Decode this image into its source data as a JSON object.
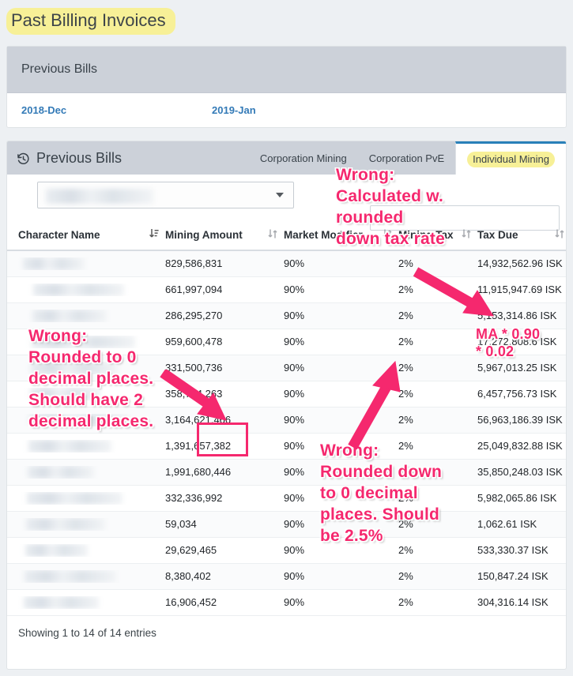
{
  "page": {
    "title": "Past Billing Invoices",
    "title_highlight_color": "#f7f097"
  },
  "previous_bills_panel": {
    "header": "Previous Bills",
    "links": [
      "2018-Dec",
      "2019-Jan"
    ],
    "link_color": "#337ab7"
  },
  "table_card": {
    "header_title": "Previous Bills",
    "header_icon": "history-icon",
    "tabs": [
      {
        "label": "Corporation Mining",
        "active": false
      },
      {
        "label": "Corporation PvE",
        "active": false
      },
      {
        "label": "Individual Mining",
        "active": true
      }
    ],
    "filter_dropdown": {
      "value": "",
      "redacted": true,
      "caret": "chevron-down-icon"
    },
    "search": {
      "value": "",
      "placeholder": ""
    },
    "columns": [
      {
        "label": "Character Name",
        "sort": "desc"
      },
      {
        "label": "Mining Amount",
        "sort": "none"
      },
      {
        "label": "Market Modifier",
        "sort": "none"
      },
      {
        "label": "Mining Tax",
        "sort": "none"
      },
      {
        "label": "Tax Due",
        "sort": "none"
      }
    ],
    "rows": [
      {
        "character_name": "",
        "mining_amount": "829,586,831",
        "market_modifier": "90%",
        "mining_tax": "2%",
        "tax_due": "14,932,562.96 ISK"
      },
      {
        "character_name": "",
        "mining_amount": "661,997,094",
        "market_modifier": "90%",
        "mining_tax": "2%",
        "tax_due": "11,915,947.69 ISK"
      },
      {
        "character_name": "",
        "mining_amount": "286,295,270",
        "market_modifier": "90%",
        "mining_tax": "2%",
        "tax_due": "5,153,314.86 ISK"
      },
      {
        "character_name": "",
        "mining_amount": "959,600,478",
        "market_modifier": "90%",
        "mining_tax": "2%",
        "tax_due": "17,272,808.6 ISK"
      },
      {
        "character_name": "",
        "mining_amount": "331,500,736",
        "market_modifier": "90%",
        "mining_tax": "2%",
        "tax_due": "5,967,013.25 ISK"
      },
      {
        "character_name": "",
        "mining_amount": "358,764,263",
        "market_modifier": "90%",
        "mining_tax": "2%",
        "tax_due": "6,457,756.73 ISK"
      },
      {
        "character_name": "",
        "mining_amount": "3,164,621,466",
        "market_modifier": "90%",
        "mining_tax": "2%",
        "tax_due": "56,963,186.39 ISK"
      },
      {
        "character_name": "",
        "mining_amount": "1,391,657,382",
        "market_modifier": "90%",
        "mining_tax": "2%",
        "tax_due": "25,049,832.88 ISK"
      },
      {
        "character_name": "",
        "mining_amount": "1,991,680,446",
        "market_modifier": "90%",
        "mining_tax": "2%",
        "tax_due": "35,850,248.03 ISK"
      },
      {
        "character_name": "",
        "mining_amount": "332,336,992",
        "market_modifier": "90%",
        "mining_tax": "2%",
        "tax_due": "5,982,065.86 ISK"
      },
      {
        "character_name": "",
        "mining_amount": "59,034",
        "market_modifier": "90%",
        "mining_tax": "2%",
        "tax_due": "1,062.61 ISK"
      },
      {
        "character_name": "",
        "mining_amount": "29,629,465",
        "market_modifier": "90%",
        "mining_tax": "2%",
        "tax_due": "533,330.37 ISK"
      },
      {
        "character_name": "",
        "mining_amount": "8,380,402",
        "market_modifier": "90%",
        "mining_tax": "2%",
        "tax_due": "150,847.24 ISK"
      },
      {
        "character_name": "",
        "mining_amount": "16,906,452",
        "market_modifier": "90%",
        "mining_tax": "2%",
        "tax_due": "304,316.14 ISK"
      }
    ],
    "footer": "Showing 1 to 14 of 14 entries"
  },
  "annotations": {
    "color": "#f5286e",
    "top_right": "Wrong:\nCalculated w.\nrounded\ndown tax rate",
    "left": "Wrong:\nRounded to 0\ndecimal places.\nShould have 2\ndecimal places.",
    "bottom": "Wrong:\nRounded down\nto 0 decimal\nplaces. Should\nbe 2.5%",
    "formula": "MA * 0.90\n* 0.02"
  }
}
